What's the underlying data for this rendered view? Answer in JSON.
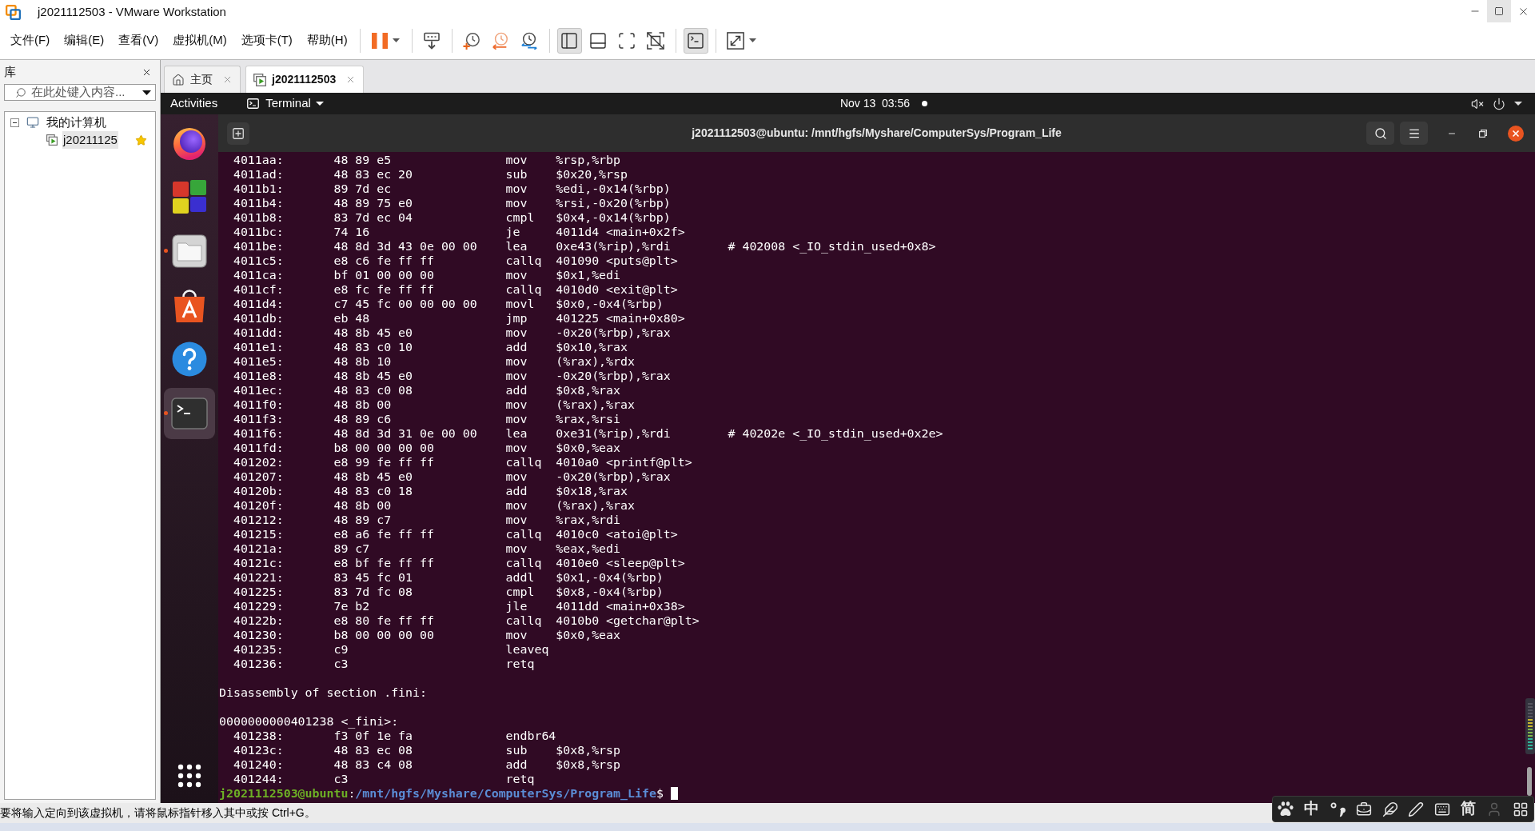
{
  "window": {
    "title": "j2021112503 - VMware Workstation"
  },
  "menu": [
    "文件(F)",
    "编辑(E)",
    "查看(V)",
    "虚拟机(M)",
    "选项卡(T)",
    "帮助(H)"
  ],
  "toolbar": {
    "groups": [
      {
        "buttons": [
          {
            "kind": "pause",
            "dropdown": true,
            "pressed": false
          }
        ]
      },
      {
        "buttons": [
          {
            "kind": "send-keys",
            "dropdown": false,
            "pressed": false
          }
        ]
      },
      {
        "buttons": [
          {
            "kind": "snapshot-take",
            "dropdown": false,
            "pressed": false
          },
          {
            "kind": "snapshot-revert",
            "dropdown": false,
            "pressed": false
          },
          {
            "kind": "snapshot-manager",
            "dropdown": false,
            "pressed": false
          }
        ]
      },
      {
        "buttons": [
          {
            "kind": "library",
            "dropdown": false,
            "pressed": true
          },
          {
            "kind": "thumbnail",
            "dropdown": false,
            "pressed": false
          },
          {
            "kind": "fullscreen",
            "dropdown": false,
            "pressed": false
          },
          {
            "kind": "unity",
            "dropdown": false,
            "pressed": false
          }
        ]
      },
      {
        "buttons": [
          {
            "kind": "console",
            "dropdown": false,
            "pressed": true
          }
        ]
      },
      {
        "buttons": [
          {
            "kind": "stretch",
            "dropdown": true,
            "pressed": false
          }
        ]
      }
    ]
  },
  "library": {
    "title": "库",
    "search": {
      "placeholder": "在此处键入内容..."
    },
    "tree": [
      {
        "label": "我的计算机",
        "expanded": true,
        "selected": false,
        "children": [
          {
            "label": "j20211125",
            "selected": true,
            "favorite": true
          }
        ]
      }
    ]
  },
  "tabs": [
    {
      "kind": "home",
      "label": "主页",
      "selected": false
    },
    {
      "kind": "vm",
      "label": "j2021112503",
      "selected": true
    }
  ],
  "guest": {
    "top_bar": {
      "activities": "Activities",
      "app_menu": "Terminal",
      "clock": "Nov 13  03:56",
      "notification": true
    },
    "dock": {
      "items": [
        {
          "kind": "browser",
          "running": false,
          "active": false
        },
        {
          "kind": "squares",
          "running": false,
          "active": false
        },
        {
          "kind": "files",
          "running": true,
          "active": false
        },
        {
          "kind": "software",
          "running": false,
          "active": false
        },
        {
          "kind": "help",
          "running": false,
          "active": false
        },
        {
          "kind": "terminal",
          "running": true,
          "active": true
        }
      ]
    },
    "terminal": {
      "title": "j2021112503@ubuntu: /mnt/hgfs/Myshare/ComputerSys/Program_Life",
      "lines": [
        {
          "kind": "asm",
          "address": "4011aa:",
          "bytes": "48 89 e5",
          "mnemonic": "mov",
          "operands": "%rsp,%rbp"
        },
        {
          "kind": "asm",
          "address": "4011ad:",
          "bytes": "48 83 ec 20",
          "mnemonic": "sub",
          "operands": "$0x20,%rsp"
        },
        {
          "kind": "asm",
          "address": "4011b1:",
          "bytes": "89 7d ec",
          "mnemonic": "mov",
          "operands": "%edi,-0x14(%rbp)"
        },
        {
          "kind": "asm",
          "address": "4011b4:",
          "bytes": "48 89 75 e0",
          "mnemonic": "mov",
          "operands": "%rsi,-0x20(%rbp)"
        },
        {
          "kind": "asm",
          "address": "4011b8:",
          "bytes": "83 7d ec 04",
          "mnemonic": "cmpl",
          "operands": "$0x4,-0x14(%rbp)"
        },
        {
          "kind": "asm",
          "address": "4011bc:",
          "bytes": "74 16",
          "mnemonic": "je",
          "operands": "4011d4 <main+0x2f>"
        },
        {
          "kind": "asm",
          "address": "4011be:",
          "bytes": "48 8d 3d 43 0e 00 00",
          "mnemonic": "lea",
          "operands": "0xe43(%rip),%rdi",
          "comment": "# 402008 <_IO_stdin_used+0x8>"
        },
        {
          "kind": "asm",
          "address": "4011c5:",
          "bytes": "e8 c6 fe ff ff",
          "mnemonic": "callq",
          "operands": "401090 <puts@plt>"
        },
        {
          "kind": "asm",
          "address": "4011ca:",
          "bytes": "bf 01 00 00 00",
          "mnemonic": "mov",
          "operands": "$0x1,%edi"
        },
        {
          "kind": "asm",
          "address": "4011cf:",
          "bytes": "e8 fc fe ff ff",
          "mnemonic": "callq",
          "operands": "4010d0 <exit@plt>"
        },
        {
          "kind": "asm",
          "address": "4011d4:",
          "bytes": "c7 45 fc 00 00 00 00",
          "mnemonic": "movl",
          "operands": "$0x0,-0x4(%rbp)"
        },
        {
          "kind": "asm",
          "address": "4011db:",
          "bytes": "eb 48",
          "mnemonic": "jmp",
          "operands": "401225 <main+0x80>"
        },
        {
          "kind": "asm",
          "address": "4011dd:",
          "bytes": "48 8b 45 e0",
          "mnemonic": "mov",
          "operands": "-0x20(%rbp),%rax"
        },
        {
          "kind": "asm",
          "address": "4011e1:",
          "bytes": "48 83 c0 10",
          "mnemonic": "add",
          "operands": "$0x10,%rax"
        },
        {
          "kind": "asm",
          "address": "4011e5:",
          "bytes": "48 8b 10",
          "mnemonic": "mov",
          "operands": "(%rax),%rdx"
        },
        {
          "kind": "asm",
          "address": "4011e8:",
          "bytes": "48 8b 45 e0",
          "mnemonic": "mov",
          "operands": "-0x20(%rbp),%rax"
        },
        {
          "kind": "asm",
          "address": "4011ec:",
          "bytes": "48 83 c0 08",
          "mnemonic": "add",
          "operands": "$0x8,%rax"
        },
        {
          "kind": "asm",
          "address": "4011f0:",
          "bytes": "48 8b 00",
          "mnemonic": "mov",
          "operands": "(%rax),%rax"
        },
        {
          "kind": "asm",
          "address": "4011f3:",
          "bytes": "48 89 c6",
          "mnemonic": "mov",
          "operands": "%rax,%rsi"
        },
        {
          "kind": "asm",
          "address": "4011f6:",
          "bytes": "48 8d 3d 31 0e 00 00",
          "mnemonic": "lea",
          "operands": "0xe31(%rip),%rdi",
          "comment": "# 40202e <_IO_stdin_used+0x2e>"
        },
        {
          "kind": "asm",
          "address": "4011fd:",
          "bytes": "b8 00 00 00 00",
          "mnemonic": "mov",
          "operands": "$0x0,%eax"
        },
        {
          "kind": "asm",
          "address": "401202:",
          "bytes": "e8 99 fe ff ff",
          "mnemonic": "callq",
          "operands": "4010a0 <printf@plt>"
        },
        {
          "kind": "asm",
          "address": "401207:",
          "bytes": "48 8b 45 e0",
          "mnemonic": "mov",
          "operands": "-0x20(%rbp),%rax"
        },
        {
          "kind": "asm",
          "address": "40120b:",
          "bytes": "48 83 c0 18",
          "mnemonic": "add",
          "operands": "$0x18,%rax"
        },
        {
          "kind": "asm",
          "address": "40120f:",
          "bytes": "48 8b 00",
          "mnemonic": "mov",
          "operands": "(%rax),%rax"
        },
        {
          "kind": "asm",
          "address": "401212:",
          "bytes": "48 89 c7",
          "mnemonic": "mov",
          "operands": "%rax,%rdi"
        },
        {
          "kind": "asm",
          "address": "401215:",
          "bytes": "e8 a6 fe ff ff",
          "mnemonic": "callq",
          "operands": "4010c0 <atoi@plt>"
        },
        {
          "kind": "asm",
          "address": "40121a:",
          "bytes": "89 c7",
          "mnemonic": "mov",
          "operands": "%eax,%edi"
        },
        {
          "kind": "asm",
          "address": "40121c:",
          "bytes": "e8 bf fe ff ff",
          "mnemonic": "callq",
          "operands": "4010e0 <sleep@plt>"
        },
        {
          "kind": "asm",
          "address": "401221:",
          "bytes": "83 45 fc 01",
          "mnemonic": "addl",
          "operands": "$0x1,-0x4(%rbp)"
        },
        {
          "kind": "asm",
          "address": "401225:",
          "bytes": "83 7d fc 08",
          "mnemonic": "cmpl",
          "operands": "$0x8,-0x4(%rbp)"
        },
        {
          "kind": "asm",
          "address": "401229:",
          "bytes": "7e b2",
          "mnemonic": "jle",
          "operands": "4011dd <main+0x38>"
        },
        {
          "kind": "asm",
          "address": "40122b:",
          "bytes": "e8 80 fe ff ff",
          "mnemonic": "callq",
          "operands": "4010b0 <getchar@plt>"
        },
        {
          "kind": "asm",
          "address": "401230:",
          "bytes": "b8 00 00 00 00",
          "mnemonic": "mov",
          "operands": "$0x0,%eax"
        },
        {
          "kind": "asm",
          "address": "401235:",
          "bytes": "c9",
          "mnemonic": "leaveq"
        },
        {
          "kind": "asm",
          "address": "401236:",
          "bytes": "c3",
          "mnemonic": "retq"
        },
        {
          "kind": "blank"
        },
        {
          "kind": "text",
          "text": "Disassembly of section .fini:"
        },
        {
          "kind": "blank"
        },
        {
          "kind": "text",
          "text": "0000000000401238 <_fini>:"
        },
        {
          "kind": "asm",
          "address": "401238:",
          "bytes": "f3 0f 1e fa",
          "mnemonic": "endbr64"
        },
        {
          "kind": "asm",
          "address": "40123c:",
          "bytes": "48 83 ec 08",
          "mnemonic": "sub",
          "operands": "$0x8,%rsp"
        },
        {
          "kind": "asm",
          "address": "401240:",
          "bytes": "48 83 c4 08",
          "mnemonic": "add",
          "operands": "$0x8,%rsp"
        },
        {
          "kind": "asm",
          "address": "401244:",
          "bytes": "c3",
          "mnemonic": "retq"
        }
      ],
      "prompt": {
        "user_host": "j2021112503@ubuntu",
        "separator": ":",
        "path": "/mnt/hgfs/Myshare/ComputerSys/Program_Life",
        "symbol": "$"
      }
    }
  },
  "status_bar": {
    "text": "要将输入定向到该虚拟机，请将鼠标指针移入其中或按 Ctrl+G。"
  },
  "ime_toolbar": {
    "items": [
      {
        "kind": "paw",
        "disabled": false
      },
      {
        "kind": "label",
        "text": "中",
        "disabled": false
      },
      {
        "kind": "punctuation",
        "disabled": false
      },
      {
        "kind": "toolbox",
        "disabled": false
      },
      {
        "kind": "feather",
        "disabled": false
      },
      {
        "kind": "pen",
        "disabled": false
      },
      {
        "kind": "keyboard",
        "disabled": false
      },
      {
        "kind": "label",
        "text": "简",
        "disabled": false
      },
      {
        "kind": "user",
        "disabled": true
      },
      {
        "kind": "grid",
        "disabled": false
      }
    ]
  }
}
